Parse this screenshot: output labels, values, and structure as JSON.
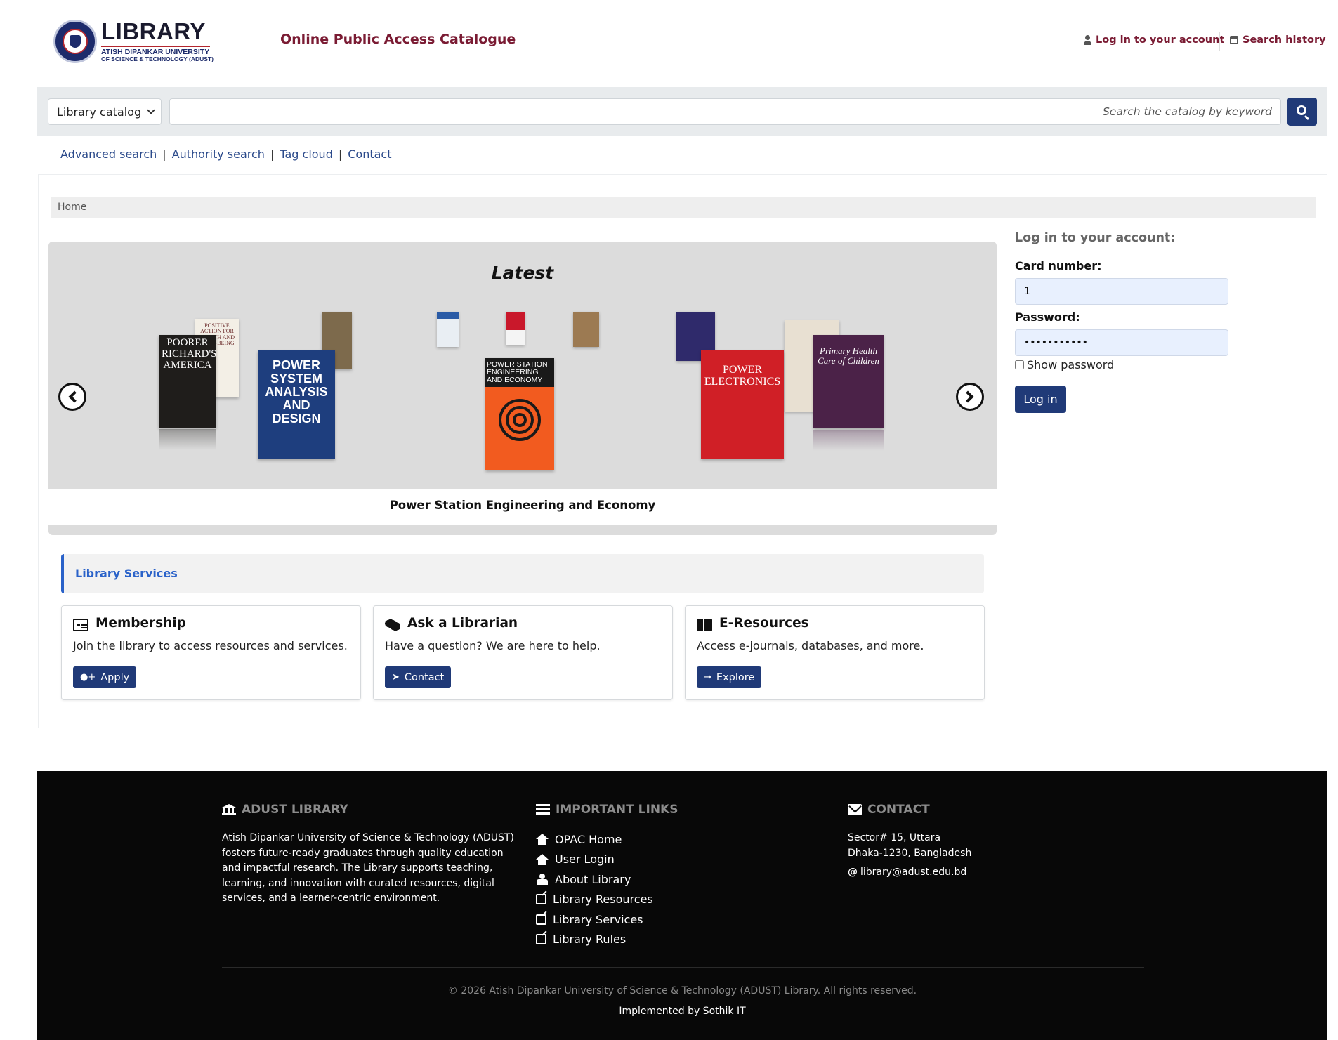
{
  "header": {
    "logo_name": "LIBRARY",
    "logo_sub1": "ATISH DIPANKAR UNIVERSITY",
    "logo_sub2": "OF SCIENCE & TECHNOLOGY (ADUST)",
    "opac_title": "Online Public Access Catalogue",
    "login_link": "Log in to your account",
    "history_link": "Search history"
  },
  "search": {
    "catalog_label": "Library catalog",
    "placeholder": "Search the catalog by keyword",
    "value": ""
  },
  "sublinks": [
    "Advanced search",
    "Authority search",
    "Tag cloud",
    "Contact"
  ],
  "breadcrumb": "Home",
  "carousel": {
    "heading": "Latest",
    "caption": "Power Station Engineering and Economy",
    "books": [
      "POORER RICHARD'S AMERICA",
      "POSITIVE ACTION FOR HEALTH AND WELL-BEING",
      "POWER SYSTEM ANALYSIS AND DESIGN",
      "POWER STATION ENGINEERING AND ECONOMY",
      "POWER ELECTRONICS",
      "Primary Health Care of Children"
    ]
  },
  "services": {
    "heading": "Library Services",
    "cards": [
      {
        "title": "Membership",
        "desc": "Join the library to access resources and services.",
        "button": "Apply",
        "icon": "id-card-icon",
        "btn_icon": "user-plus-icon"
      },
      {
        "title": "Ask a Librarian",
        "desc": "Have a question? We are here to help.",
        "button": "Contact",
        "icon": "comments-icon",
        "btn_icon": "paper-plane-icon"
      },
      {
        "title": "E-Resources",
        "desc": "Access e-journals, databases, and more.",
        "button": "Explore",
        "icon": "book-open-icon",
        "btn_icon": "arrow-right-icon"
      }
    ]
  },
  "login": {
    "title": "Log in to your account:",
    "card_label": "Card number:",
    "card_value": "1",
    "password_label": "Password:",
    "password_value": "•••••••••••",
    "show_password": "Show password",
    "button": "Log in"
  },
  "footer": {
    "col1_head": "ADUST LIBRARY",
    "about": "Atish Dipankar University of Science & Technology (ADUST) fosters future-ready graduates through quality education and impactful research. The Library supports teaching, learning, and innovation with curated resources, digital services, and a learner-centric environment.",
    "col2_head": "IMPORTANT LINKS",
    "links": [
      "OPAC Home",
      "User Login",
      "About Library",
      "Library Resources",
      "Library Services",
      "Library Rules"
    ],
    "col3_head": "CONTACT",
    "address1": "Sector# 15, Uttara",
    "address2": "Dhaka-1230, Bangladesh",
    "email": "library@adust.edu.bd",
    "copyright": "© 2026 Atish Dipankar University of Science & Technology (ADUST) Library. All rights reserved.",
    "implemented": "Implemented by Sothik IT"
  },
  "colors": {
    "brand_dark_blue": "#203a78",
    "title_maroon": "#7a1b33",
    "service_blue": "#2a62c9",
    "footer_bg": "#080808"
  }
}
